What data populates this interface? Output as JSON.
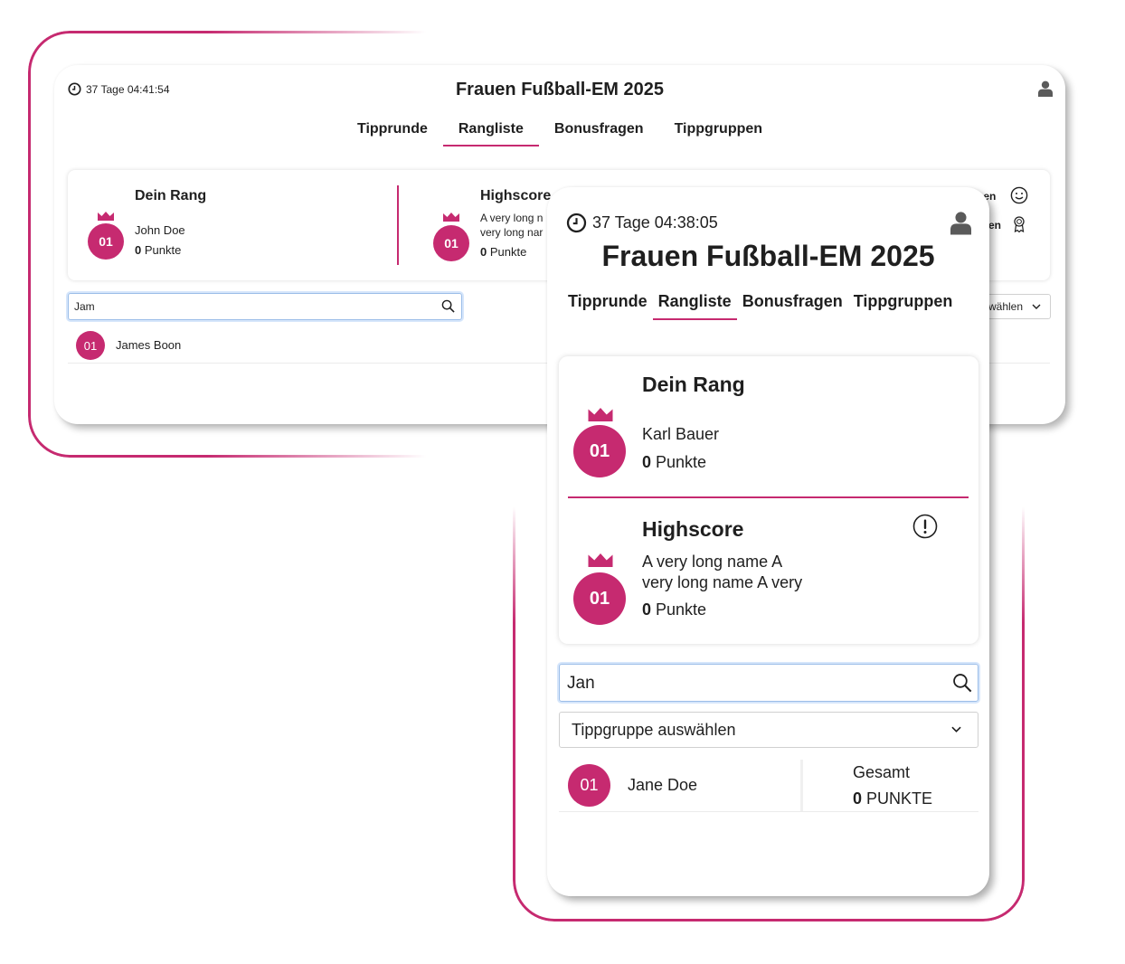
{
  "back_view": {
    "timer": "37 Tage 04:41:54",
    "title": "Frauen Fußball-EM 2025",
    "tabs": [
      "Tipprunde",
      "Rangliste",
      "Bonusfragen",
      "Tippgruppen"
    ],
    "active_tab": "Rangliste",
    "my_rank": {
      "heading": "Dein Rang",
      "rank": "01",
      "name": "John Doe",
      "points_value": "0",
      "points_label": "Punkte"
    },
    "highscore": {
      "heading": "Highscore",
      "rank": "01",
      "name_line1": "A very long n",
      "name_line2": "very long nar",
      "points_value": "0",
      "points_label": "Punkte"
    },
    "right_labels": {
      "line1": "nen",
      "line2": "en"
    },
    "search": {
      "value": "Jam"
    },
    "group_select": {
      "value": "wählen"
    },
    "results": [
      {
        "rank": "01",
        "name": "James Boon"
      }
    ]
  },
  "front_view": {
    "timer": "37 Tage 04:38:05",
    "title": "Frauen Fußball-EM 2025",
    "tabs": [
      "Tipprunde",
      "Rangliste",
      "Bonusfragen",
      "Tippgruppen"
    ],
    "active_tab": "Rangliste",
    "my_rank": {
      "heading": "Dein Rang",
      "rank": "01",
      "name": "Karl Bauer",
      "points_value": "0",
      "points_label": "Punkte"
    },
    "highscore": {
      "heading": "Highscore",
      "rank": "01",
      "name_line1": "A very long name A",
      "name_line2": "very long name A very",
      "points_value": "0",
      "points_label": "Punkte"
    },
    "search": {
      "value": "Jan"
    },
    "group_select": {
      "value": "Tippgruppe auswählen"
    },
    "results": [
      {
        "rank": "01",
        "name": "Jane Doe",
        "total_label": "Gesamt",
        "points_value": "0",
        "points_label": "PUNKTE"
      }
    ]
  },
  "colors": {
    "accent": "#c62a70",
    "focus": "#9bbde8",
    "text": "#1f1f1f"
  },
  "icons": [
    "clock-icon",
    "user-icon",
    "crown-icon",
    "search-icon",
    "chevron-down-icon",
    "smiley-icon",
    "award-icon",
    "info-icon"
  ]
}
